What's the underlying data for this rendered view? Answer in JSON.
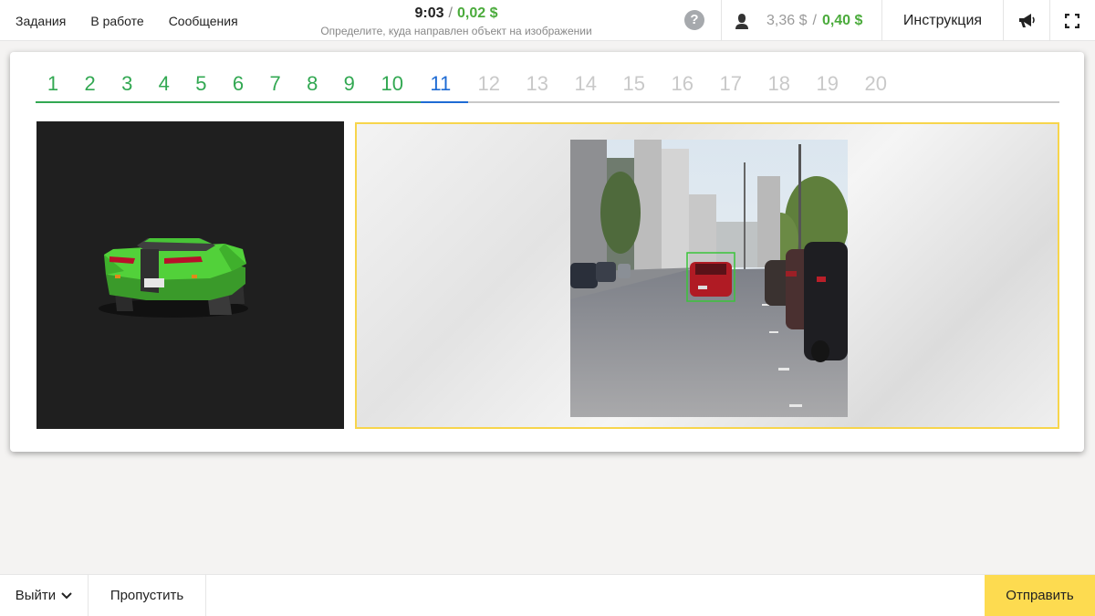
{
  "nav": {
    "tasks": "Задания",
    "in_progress": "В работе",
    "messages": "Сообщения"
  },
  "status": {
    "timer": "9:03",
    "reward": "0,02 $",
    "hint": "Определите, куда направлен объект на изображении"
  },
  "help": {
    "label": "?"
  },
  "balance": {
    "total": "3,36 $",
    "pending": "0,40 $"
  },
  "instruction_label": "Инструкция",
  "icons": {
    "help": "question-icon",
    "user": "user-icon",
    "announce": "megaphone-icon",
    "fullscreen": "fullscreen-icon"
  },
  "steps": {
    "items": [
      "1",
      "2",
      "3",
      "4",
      "5",
      "6",
      "7",
      "8",
      "9",
      "10",
      "11",
      "12",
      "13",
      "14",
      "15",
      "16",
      "17",
      "18",
      "19",
      "20"
    ],
    "current": 11
  },
  "footer": {
    "exit": "Выйти",
    "skip": "Пропустить",
    "submit": "Отправить"
  },
  "colors": {
    "done": "#32a852",
    "current": "#1e6bd4",
    "future": "#c9c9c9",
    "selection_border": "#f7d54c",
    "submit_bg": "#fddb50",
    "bbox": "#3ac43a"
  }
}
